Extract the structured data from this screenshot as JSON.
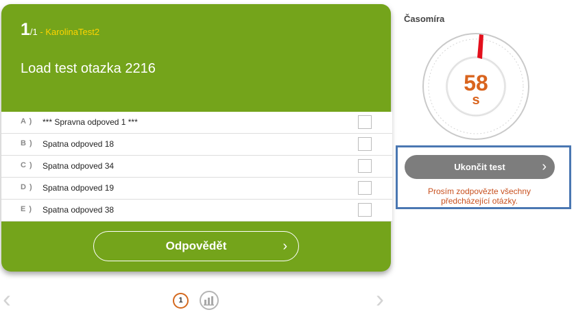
{
  "question_card": {
    "current": "1",
    "total": "/1",
    "separator": " - ",
    "test_name": "KarolinaTest2",
    "question_text": "Load test otazka 2216",
    "answers": [
      {
        "letter": "A )",
        "text": "*** Spravna odpoved 1 ***",
        "checked": false
      },
      {
        "letter": "B )",
        "text": "Spatna odpoved 18",
        "checked": false
      },
      {
        "letter": "C )",
        "text": "Spatna odpoved 34",
        "checked": false
      },
      {
        "letter": "D )",
        "text": "Spatna odpoved 19",
        "checked": false
      },
      {
        "letter": "E )",
        "text": "Spatna odpoved 38",
        "checked": false
      }
    ],
    "submit_label": "Odpovědět",
    "colors": {
      "card": "#74a41b",
      "accent": "#ffd400"
    }
  },
  "pagination": {
    "current_page": "1",
    "prev_icon": "chevron-left-icon",
    "next_icon": "chevron-right-icon",
    "stats_icon": "bar-chart-icon"
  },
  "timer": {
    "title": "Časomíra",
    "value": "58",
    "unit": "s",
    "color": "#d9641e"
  },
  "end_test": {
    "button_label": "Ukončit test",
    "note_line1": "Prosím zodpovězte všechny",
    "note_line2": "předcházející otázky.",
    "highlight_color": "#4a77b2"
  }
}
